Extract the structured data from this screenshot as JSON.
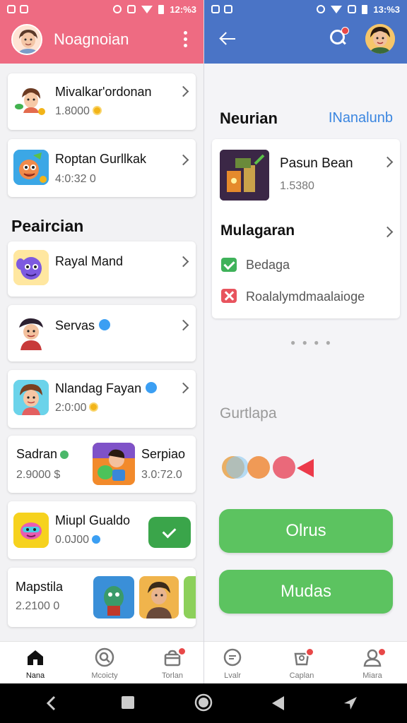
{
  "left": {
    "status_time": "12:%3",
    "app_title": "Noagnoian",
    "cards_top": [
      {
        "name": "Mivalkar'ordonan",
        "sub": "1.8000"
      },
      {
        "name": "Roptan Gurllkak",
        "sub": "4:0:32 0"
      }
    ],
    "section_title": "Peaircian",
    "cards": [
      {
        "name": "Rayal Mand",
        "sub": ""
      },
      {
        "name": "Servas",
        "sub": ""
      },
      {
        "name": "Nlandag Fayan",
        "sub": "2:0:00"
      },
      {
        "name": "Sadran",
        "sub": "2.9000 $",
        "name2": "Serpiao",
        "sub2": "3.0:72.0"
      },
      {
        "name": "Miupl Gualdo",
        "sub": "0.0J00"
      },
      {
        "name": "Mapstila",
        "sub": "2.2100 0"
      }
    ],
    "nav": [
      {
        "label": "Nana",
        "icon": "home-icon"
      },
      {
        "label": "Mcoicty",
        "icon": "search-circle-icon"
      },
      {
        "label": "Torlan",
        "icon": "store-icon"
      }
    ]
  },
  "right": {
    "status_time": "13:%3",
    "heading": "Neurian",
    "link": "INanalunb",
    "product": {
      "name": "Pasun Bean",
      "sub": "1.5380"
    },
    "options_title": "Mulagaran",
    "options": [
      "Bedaga",
      "Roalalymdmaalaioge"
    ],
    "section": "Gurtlapa",
    "buttons": [
      "Olrus",
      "Mudas"
    ],
    "nav": [
      {
        "label": "Lvalr",
        "icon": "chat-icon"
      },
      {
        "label": "Caplan",
        "icon": "cart-icon"
      },
      {
        "label": "Miara",
        "icon": "profile-icon"
      }
    ]
  },
  "colors": {
    "left_header": "#ee6b82",
    "right_header": "#4a74c6",
    "primary_green": "#5cc360",
    "link_blue": "#3b86e0",
    "badge_red": "#e84848"
  }
}
